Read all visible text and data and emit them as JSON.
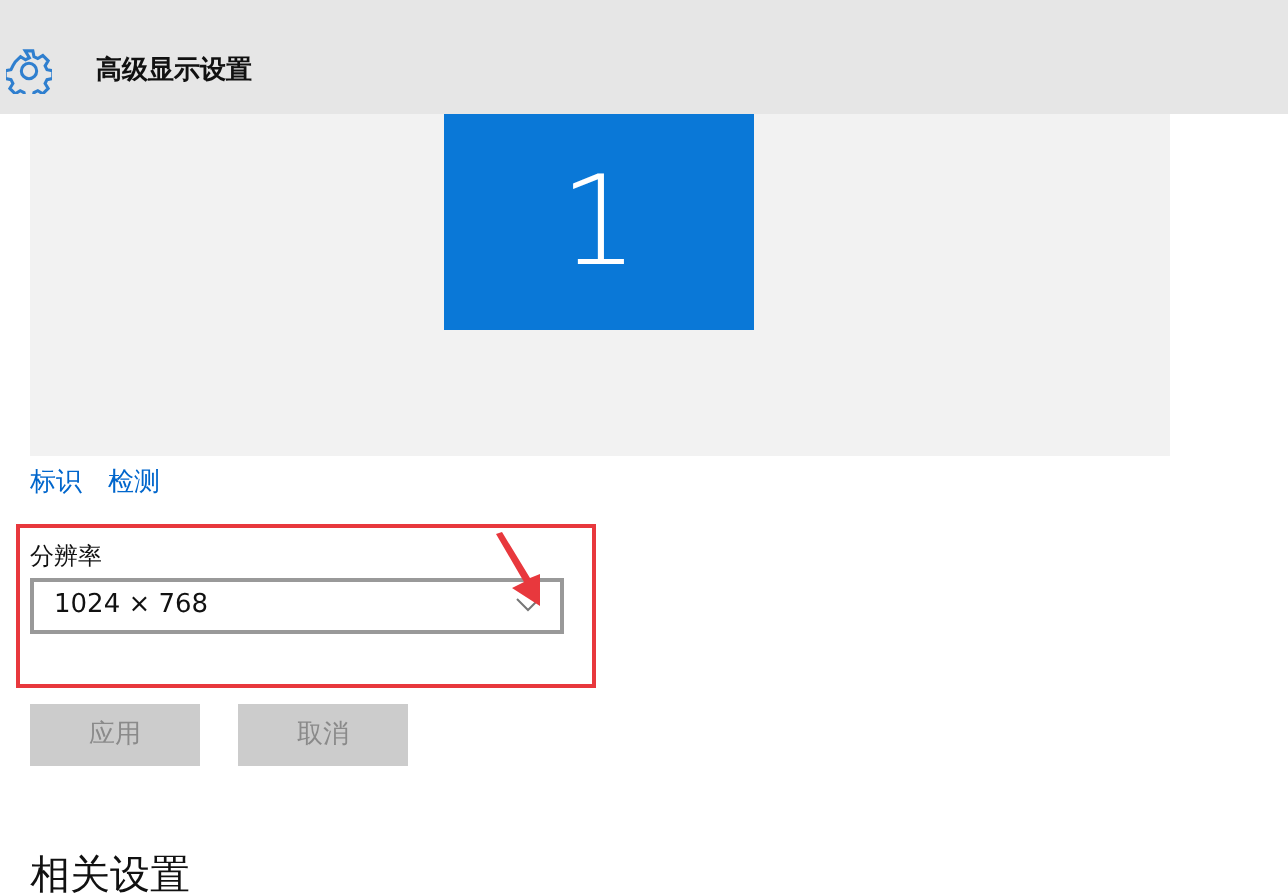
{
  "header": {
    "title": "高级显示设置"
  },
  "display_preview": {
    "monitors": [
      {
        "label": "1",
        "selected": true
      }
    ]
  },
  "links": [
    {
      "label": "标识"
    },
    {
      "label": "检测"
    }
  ],
  "resolution": {
    "label": "分辨率",
    "value": "1024 × 768"
  },
  "annotation": {
    "highlight_box": true,
    "pointer_arrow": true
  },
  "buttons": [
    {
      "label": "应用",
      "disabled": true
    },
    {
      "label": "取消",
      "disabled": true
    }
  ],
  "section_heading": "相关设置"
}
